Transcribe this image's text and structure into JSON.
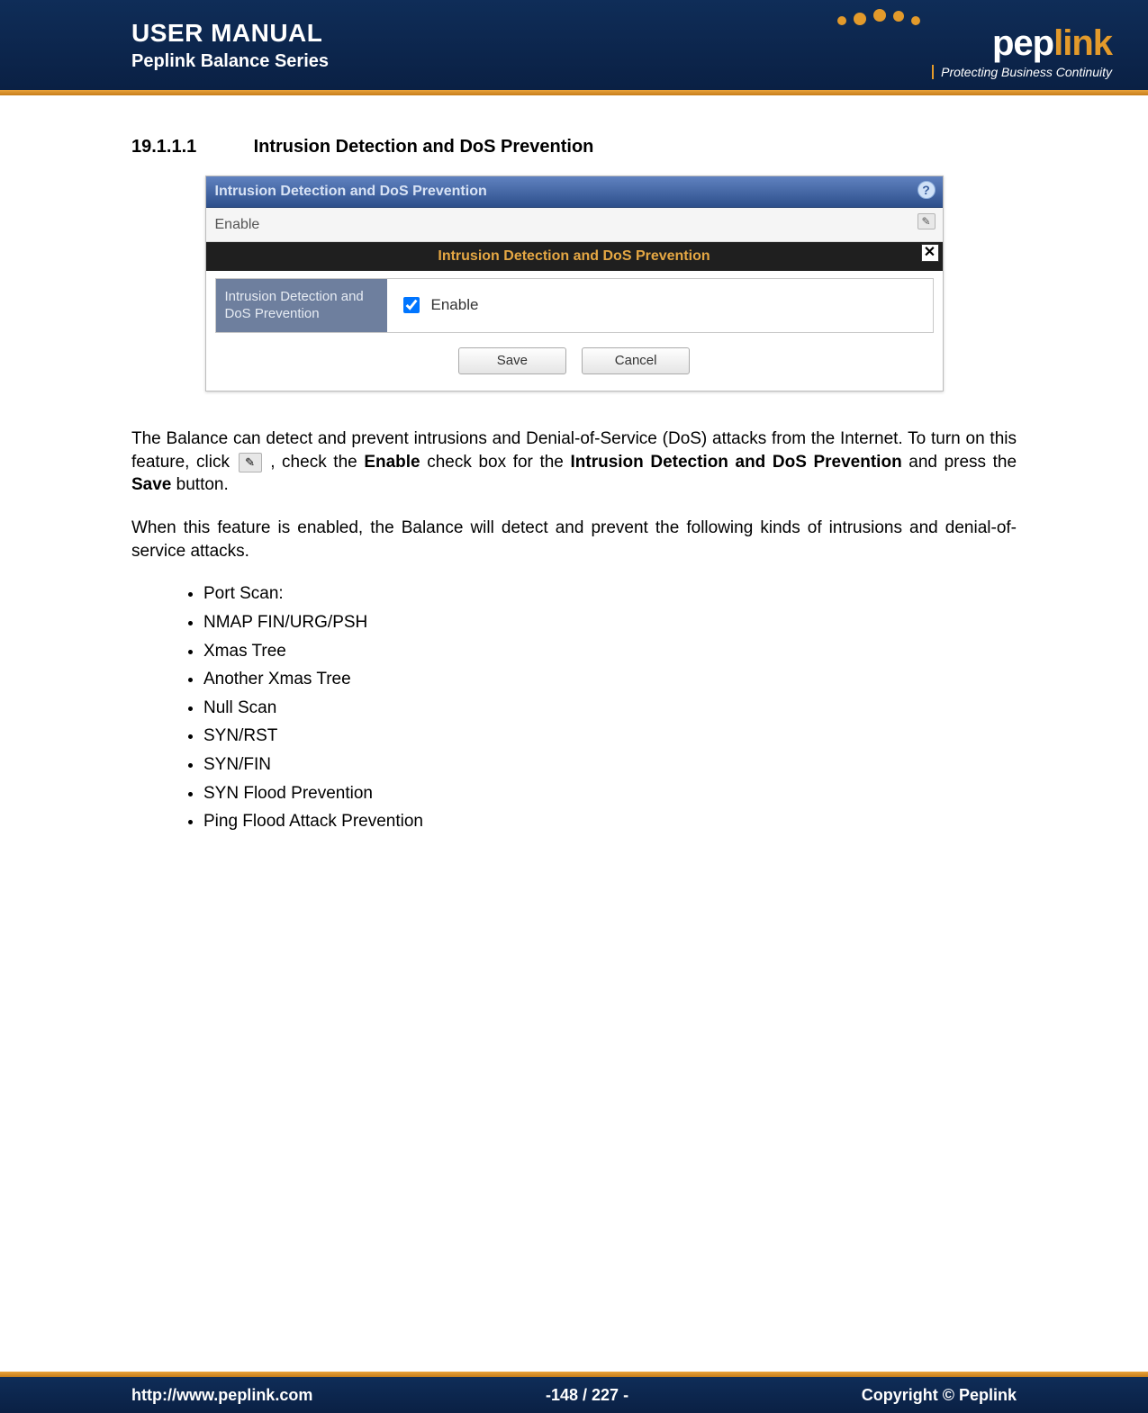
{
  "header": {
    "title": "USER MANUAL",
    "subtitle": "Peplink Balance Series",
    "logo_brand_pre": "pep",
    "logo_brand_post": "link",
    "logo_tagline": "Protecting Business Continuity"
  },
  "section": {
    "number": "19.1.1.1",
    "title": "Intrusion Detection and DoS Prevention"
  },
  "screenshot": {
    "panel_title": "Intrusion Detection and DoS Prevention",
    "row1_label": "Enable",
    "help_glyph": "?",
    "edit_glyph": "✎",
    "modal_title": "Intrusion Detection and DoS Prevention",
    "close_glyph": "✕",
    "modal_field_label": "Intrusion Detection and DoS Prevention",
    "enable_label": "Enable",
    "enable_checked": true,
    "save_label": "Save",
    "cancel_label": "Cancel"
  },
  "body": {
    "p1a": "The Balance can detect and prevent intrusions and Denial-of-Service (DoS) attacks from the Internet. To turn on this feature, click ",
    "p1b": ", check the ",
    "p1_bold1": "Enable",
    "p1c": "check box for the ",
    "p1_bold2": "Intrusion Detection and DoS Prevention",
    "p1d": "and press the ",
    "p1_bold3": "Save",
    "p1e": "button.",
    "p2": "When this feature is enabled, the Balance will detect and prevent the following kinds of intrusions and denial-of-service attacks."
  },
  "attacks": [
    "Port Scan:",
    "NMAP FIN/URG/PSH",
    "Xmas Tree",
    "Another Xmas Tree",
    "Null Scan",
    "SYN/RST",
    "SYN/FIN",
    "SYN Flood Prevention",
    "Ping Flood Attack Prevention"
  ],
  "footer": {
    "url": "http://www.peplink.com",
    "page": "-148 / 227 -",
    "copyright": "Copyright ©  Peplink"
  }
}
